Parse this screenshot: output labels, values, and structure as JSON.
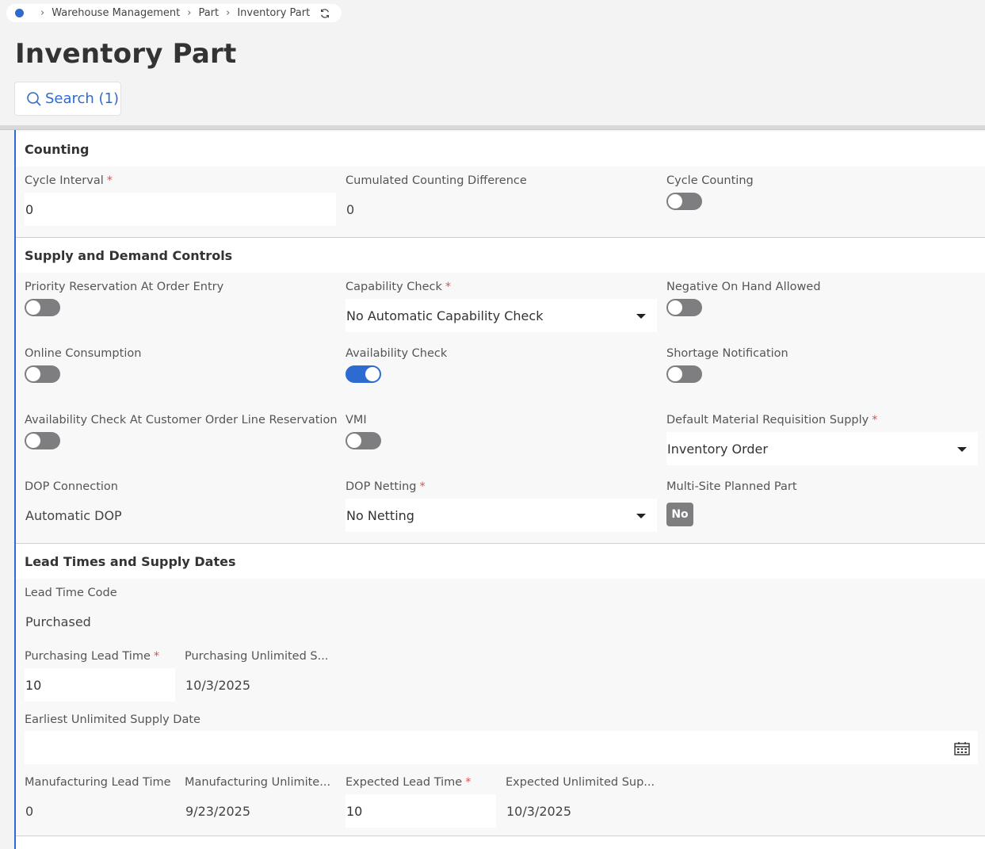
{
  "breadcrumb": {
    "items": [
      "Warehouse Management",
      "Part",
      "Inventory Part"
    ]
  },
  "page": {
    "title": "Inventory Part",
    "search_label": "Search (1)"
  },
  "colors": {
    "accent": "#2e6bd1",
    "required": "#d9534f",
    "toggle_off": "#7e7e80"
  },
  "counting": {
    "title": "Counting",
    "cycle_interval": {
      "label": "Cycle Interval",
      "value": "0"
    },
    "cumulated_difference": {
      "label": "Cumulated Counting Difference",
      "value": "0"
    },
    "cycle_counting": {
      "label": "Cycle Counting",
      "on": false
    }
  },
  "supply": {
    "title": "Supply and Demand Controls",
    "priority_reservation": {
      "label": "Priority Reservation At Order Entry",
      "on": false
    },
    "capability_check": {
      "label": "Capability Check",
      "value": "No Automatic Capability Check"
    },
    "negative_on_hand": {
      "label": "Negative On Hand Allowed",
      "on": false
    },
    "online_consumption": {
      "label": "Online Consumption",
      "on": false
    },
    "availability_check": {
      "label": "Availability Check",
      "on": true
    },
    "shortage_notification": {
      "label": "Shortage Notification",
      "on": false
    },
    "avail_check_col_reservation": {
      "label": "Availability Check At Customer Order Line Reservation",
      "on": false
    },
    "vmi": {
      "label": "VMI",
      "on": false
    },
    "default_mat_req_supply": {
      "label": "Default Material Requisition Supply",
      "value": "Inventory Order"
    },
    "dop_connection": {
      "label": "DOP Connection",
      "value": "Automatic DOP"
    },
    "dop_netting": {
      "label": "DOP Netting",
      "value": "No Netting"
    },
    "multi_site_planned": {
      "label": "Multi-Site Planned Part",
      "value": "No"
    }
  },
  "lead": {
    "title": "Lead Times and Supply Dates",
    "lead_time_code": {
      "label": "Lead Time Code",
      "value": "Purchased"
    },
    "purchasing_lead_time": {
      "label": "Purchasing Lead Time",
      "value": "10"
    },
    "purchasing_unlimited": {
      "label": "Purchasing Unlimited S...",
      "value": "10/3/2025"
    },
    "earliest_unlimited": {
      "label": "Earliest Unlimited Supply Date",
      "value": ""
    },
    "manufacturing_lead_time": {
      "label": "Manufacturing Lead Time",
      "value": "0"
    },
    "manufacturing_unlimited": {
      "label": "Manufacturing Unlimite...",
      "value": "9/23/2025"
    },
    "expected_lead_time": {
      "label": "Expected Lead Time",
      "value": "10"
    },
    "expected_unlimited": {
      "label": "Expected Unlimited Sup...",
      "value": "10/3/2025"
    }
  }
}
